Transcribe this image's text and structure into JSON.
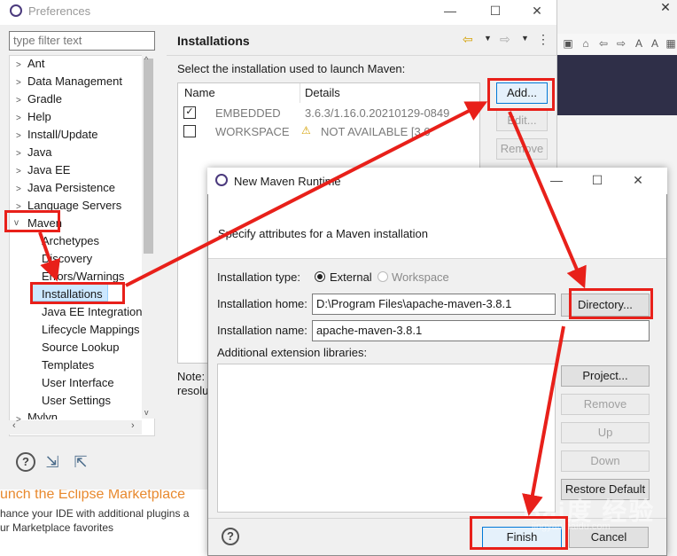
{
  "prefs": {
    "title": "Preferences",
    "filter_placeholder": "type filter text",
    "tree": [
      {
        "label": "Ant",
        "expanded": false
      },
      {
        "label": "Data Management",
        "expanded": false
      },
      {
        "label": "Gradle",
        "expanded": false
      },
      {
        "label": "Help",
        "expanded": false
      },
      {
        "label": "Install/Update",
        "expanded": false
      },
      {
        "label": "Java",
        "expanded": false
      },
      {
        "label": "Java EE",
        "expanded": false
      },
      {
        "label": "Java Persistence",
        "expanded": false
      },
      {
        "label": "Language Servers",
        "expanded": false
      },
      {
        "label": "Maven",
        "expanded": true
      },
      {
        "label": "Archetypes"
      },
      {
        "label": "Discovery"
      },
      {
        "label": "Errors/Warnings"
      },
      {
        "label": "Installations",
        "selected": true
      },
      {
        "label": "Java EE Integration"
      },
      {
        "label": "Lifecycle Mappings"
      },
      {
        "label": "Source Lookup"
      },
      {
        "label": "Templates"
      },
      {
        "label": "User Interface"
      },
      {
        "label": "User Settings"
      },
      {
        "label": "Mylyn",
        "expanded": false
      }
    ],
    "page_title": "Installations",
    "select_label": "Select the installation used to launch Maven:",
    "table": {
      "headers": [
        "Name",
        "Details"
      ],
      "rows": [
        {
          "checked": true,
          "name": "EMBEDDED",
          "details": "3.6.3/1.16.0.20210129-0849"
        },
        {
          "checked": false,
          "name": "WORKSPACE",
          "details": "NOT AVAILABLE [3.0"
        }
      ]
    },
    "buttons": {
      "add": "Add...",
      "edit": "Edit...",
      "remove": "Remove"
    },
    "note_label": "Note:",
    "note_label2": "resolu"
  },
  "background": {
    "market_title": "unch the Eclipse Marketplace",
    "market_line1": "hance your IDE with additional plugins a",
    "market_line2": "ur Marketplace favorites"
  },
  "dialog": {
    "title": "New Maven Runtime",
    "description": "Specify attributes for a Maven installation",
    "installation_type_label": "Installation type:",
    "type_options": {
      "external": "External",
      "workspace": "Workspace",
      "selected": "External"
    },
    "home_label": "Installation home:",
    "home_value": "D:\\Program Files\\apache-maven-3.8.1",
    "directory_button": "Directory...",
    "name_label": "Installation name:",
    "name_value": "apache-maven-3.8.1",
    "ext_label": "Additional extension libraries:",
    "side_buttons": {
      "project": "Project...",
      "remove": "Remove",
      "up": "Up",
      "down": "Down",
      "restore": "Restore Default"
    },
    "finish": "Finish",
    "cancel": "Cancel"
  },
  "colors": {
    "annotation_red": "#e8201a",
    "selection": "#cce8ff",
    "market_orange": "#e8892e"
  },
  "watermark": {
    "text": "Bai度 经验",
    "sub": "jingyan.baidu.com"
  }
}
